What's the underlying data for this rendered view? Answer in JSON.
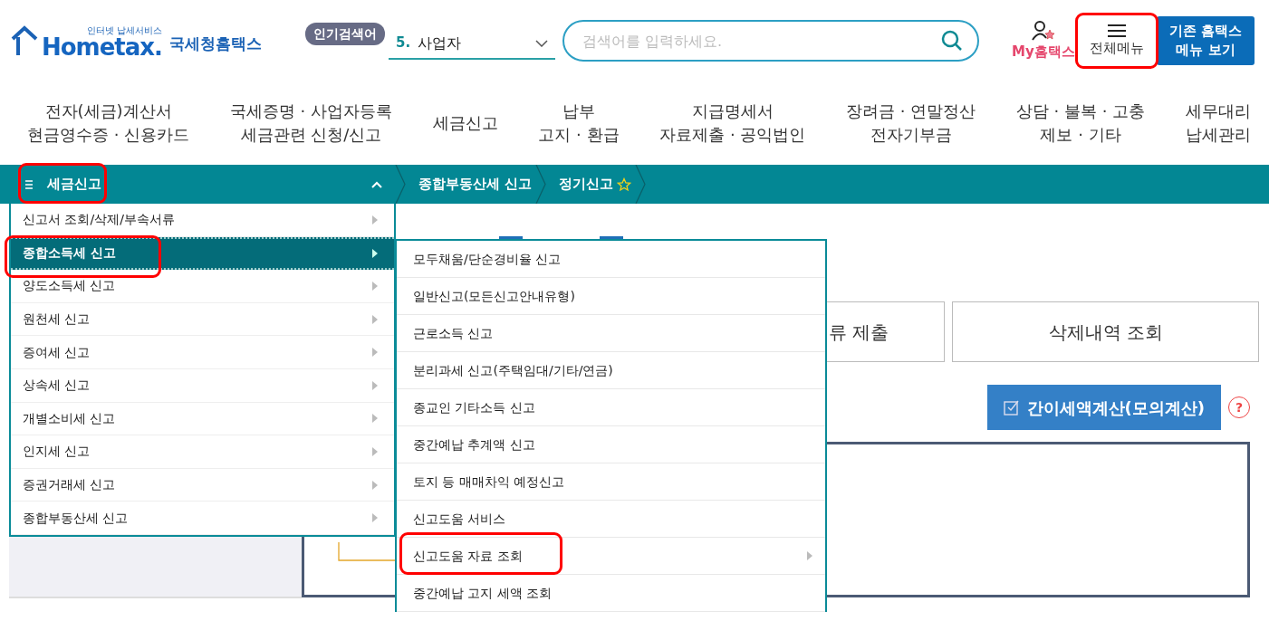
{
  "header": {
    "logo": {
      "tagline": "인터넷 납세서비스",
      "wordmark": "Hometax.",
      "name": "국세청홈택스"
    },
    "popular_search": {
      "badge": "인기검색어",
      "rank": "5.",
      "term": "사업자"
    },
    "search": {
      "placeholder": "검색어를 입력하세요."
    },
    "my_hometax": "My홈택스",
    "full_menu": {
      "label": "전체메뉴",
      "highlighted": true
    },
    "legacy_button": "기존 홈택스\n메뉴 보기"
  },
  "main_nav": [
    "전자(세금)계산서\n현금영수증 · 신용카드",
    "국세증명 · 사업자등록\n세금관련 신청/신고",
    "세금신고",
    "납부\n고지 · 환급",
    "지급명세서\n자료제출 · 공익법인",
    "장려금 · 연말정산\n전자기부금",
    "상담 · 불복 · 고충\n제보 · 기타",
    "세무대리\n납세관리"
  ],
  "location_bar": {
    "menu_title": {
      "label": "세금신고",
      "highlighted": true,
      "expanded": true
    },
    "breadcrumbs": [
      "종합부동산세 신고",
      "정기신고"
    ]
  },
  "menu": {
    "items": [
      {
        "label": "신고서 조회/삭제/부속서류",
        "selected": false,
        "highlighted": false
      },
      {
        "label": "종합소득세 신고",
        "selected": true,
        "highlighted": true
      },
      {
        "label": "양도소득세 신고",
        "selected": false,
        "highlighted": false
      },
      {
        "label": "원천세 신고",
        "selected": false,
        "highlighted": false
      },
      {
        "label": "증여세 신고",
        "selected": false,
        "highlighted": false
      },
      {
        "label": "상속세 신고",
        "selected": false,
        "highlighted": false
      },
      {
        "label": "개별소비세 신고",
        "selected": false,
        "highlighted": false
      },
      {
        "label": "인지세 신고",
        "selected": false,
        "highlighted": false
      },
      {
        "label": "증권거래세 신고",
        "selected": false,
        "highlighted": false
      },
      {
        "label": "종합부동산세 신고",
        "selected": false,
        "highlighted": false
      }
    ],
    "submenu": [
      {
        "label": "모두채움/단순경비율 신고",
        "has_children": false,
        "highlighted": false
      },
      {
        "label": "일반신고(모든신고안내유형)",
        "has_children": false,
        "highlighted": false
      },
      {
        "label": "근로소득 신고",
        "has_children": false,
        "highlighted": false
      },
      {
        "label": "분리과세 신고(주택임대/기타/연금)",
        "has_children": false,
        "highlighted": false
      },
      {
        "label": "종교인 기타소득 신고",
        "has_children": false,
        "highlighted": false
      },
      {
        "label": "중간예납 추계액 신고",
        "has_children": false,
        "highlighted": false
      },
      {
        "label": "토지 등 매매차익 예정신고",
        "has_children": false,
        "highlighted": false
      },
      {
        "label": "신고도움 서비스",
        "has_children": false,
        "highlighted": false
      },
      {
        "label": "신고도움 자료 조회",
        "has_children": true,
        "highlighted": true
      },
      {
        "label": "중간예납 고지 세액 조회",
        "has_children": false,
        "highlighted": false
      }
    ]
  },
  "content": {
    "tab_buttons": [
      "류 제출",
      "삭제내역 조회"
    ],
    "calc_button": "간이세액계산(모의계산)",
    "help": "?"
  }
}
